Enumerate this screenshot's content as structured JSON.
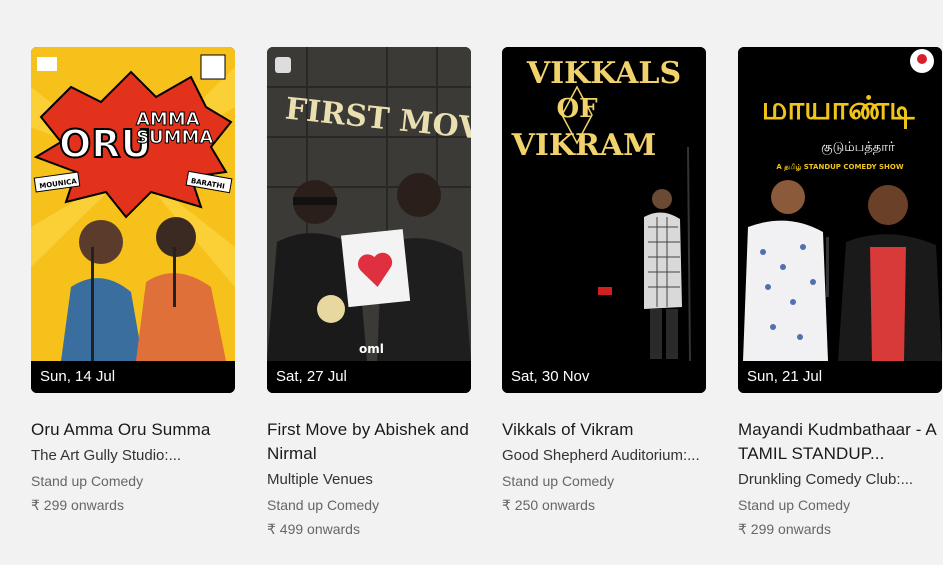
{
  "events": [
    {
      "poster": {
        "headline_top": "ORU",
        "headline_mid": "AMMA",
        "headline_bottom": "SUMMA",
        "name_left": "MOUNICA",
        "name_right": "BARATHI",
        "colors": {
          "bg": "#f5c11a",
          "burst": "#e2321c",
          "text": "#ffffff"
        }
      },
      "date": "Sun, 14 Jul",
      "title": "Oru Amma Oru Summa",
      "venue": "The Art Gully Studio:...",
      "category": "Stand up Comedy",
      "price": "₹ 299 onwards"
    },
    {
      "poster": {
        "headline": "FIRST MOVE",
        "colors": {
          "bg": "#3c3a36",
          "text": "#e9dfb0",
          "heart": "#e03040"
        }
      },
      "date": "Sat, 27 Jul",
      "title": "First Move by Abishek and Nirmal",
      "venue": "Multiple Venues",
      "category": "Stand up Comedy",
      "price": "₹ 499 onwards"
    },
    {
      "poster": {
        "line1": "VIKKALS",
        "line2": "OF",
        "line3": "VIKRAM",
        "colors": {
          "bg": "#000000",
          "text": "#f2d26a"
        }
      },
      "date": "Sat, 30 Nov",
      "title": "Vikkals of Vikram",
      "venue": "Good Shepherd Auditorium:...",
      "category": "Stand up Comedy",
      "price": "₹ 250 onwards"
    },
    {
      "poster": {
        "tamil_title": "மாயாண்டி",
        "tamil_sub": "குடும்பத்தார்",
        "tagline": "A தமிழ் STANDUP COMEDY SHOW",
        "colors": {
          "bg": "#000000",
          "text": "#f0c419"
        }
      },
      "date": "Sun, 21 Jul",
      "title": "Mayandi Kudmbathaar - A TAMIL STANDUP...",
      "venue": "Drunkling Comedy Club:...",
      "category": "Stand up Comedy",
      "price": "₹ 299 onwards"
    }
  ]
}
